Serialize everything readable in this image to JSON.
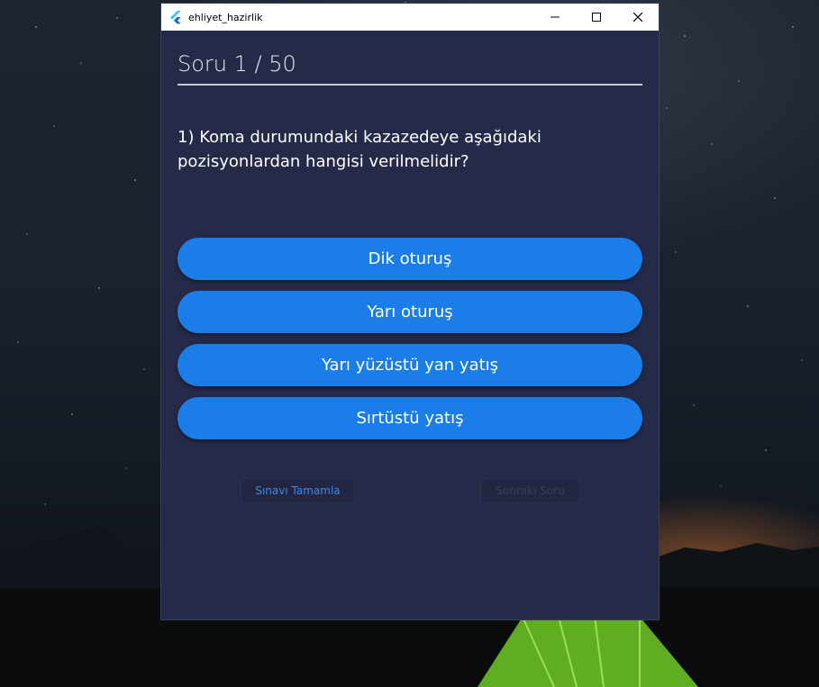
{
  "window": {
    "title": "ehliyet_hazirlik",
    "controls": [
      "minimize-icon",
      "maximize-icon",
      "close-icon"
    ]
  },
  "quiz": {
    "counter": "Soru 1 / 50",
    "question": "1) Koma durumundaki kazazedeye aşağıdaki pozisyonlardan hangisi verilmelidir?",
    "options": [
      {
        "label": "Dik oturuş"
      },
      {
        "label": "Yarı oturuş"
      },
      {
        "label": "Yarı yüzüstü yan yatış"
      },
      {
        "label": "Sırtüstü yatış"
      }
    ],
    "finish_label": "Sınavı Tamamla",
    "next_label": "Sonraki Soru"
  },
  "colors": {
    "window_background": "#252a49",
    "option_button": "#1a7de8",
    "finish_text": "#3d8be8",
    "next_text_disabled": "#3a3e5a"
  }
}
